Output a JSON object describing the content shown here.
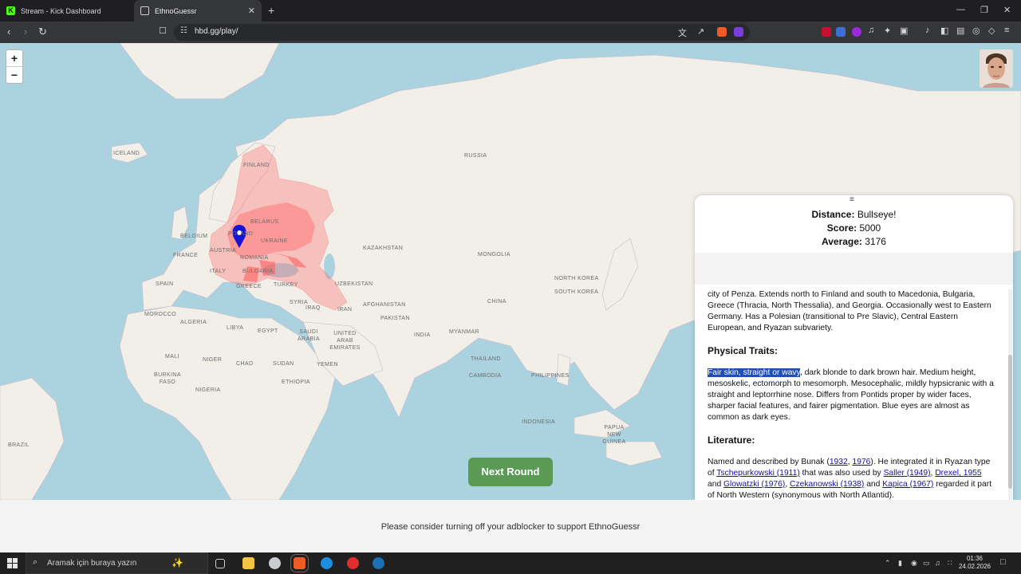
{
  "browser": {
    "tabs": [
      {
        "label": "Stream - Kick Dashboard",
        "active": false
      },
      {
        "label": "EthnoGuessr",
        "active": true
      }
    ],
    "new_tab": "+",
    "url": "hbd.gg/play/",
    "window_controls": {
      "minimize": "—",
      "restore": "❐",
      "close": "✕"
    }
  },
  "map": {
    "zoom_in": "+",
    "zoom_out": "−",
    "labels": {
      "iceland": "ICELAND",
      "finland": "FINLAND",
      "russia": "RUSSIA",
      "belarus": "BELARUS",
      "poland": "POLAND",
      "ukraine": "UKRAINE",
      "belgium": "BELGIUM",
      "austria": "AUSTRIA",
      "france": "FRANCE",
      "romania": "ROMANIA",
      "italy": "ITALY",
      "bulgaria": "BULGARIA",
      "greece": "GREECE",
      "turkey": "TURKEY",
      "spain": "SPAIN",
      "kazakhstan": "KAZAKHSTAN",
      "mongolia": "MONGOLIA",
      "uzbekistan": "UZBEKISTAN",
      "north_korea": "NORTH KOREA",
      "south_korea": "SOUTH KOREA",
      "china": "CHINA",
      "syria": "SYRIA",
      "iraq": "IRAQ",
      "iran": "IRAN",
      "afghanistan": "AFGHANISTAN",
      "pakistan": "PAKISTAN",
      "morocco": "MOROCCO",
      "algeria": "ALGERIA",
      "libya": "LIBYA",
      "egypt": "EGYPT",
      "saudi_arabia": "SAUDI ARABIA",
      "uae": "UNITED ARAB EMIRATES",
      "india": "INDIA",
      "myanmar": "MYANMAR",
      "thailand": "THAILAND",
      "philippines": "PHILIPPINES",
      "cambodia": "CAMBODIA",
      "mali": "MALI",
      "niger": "NIGER",
      "chad": "CHAD",
      "sudan": "SUDAN",
      "burkina_faso": "BURKINA FASO",
      "yemen": "YEMEN",
      "nigeria": "NIGERIA",
      "ethiopia": "ETHIOPIA",
      "indonesia": "INDONESIA",
      "brazil": "BRAZIL",
      "papua": "PAPUA NEW GUINEA"
    }
  },
  "result": {
    "handle": "≡",
    "distance_label": "Distance:",
    "distance_value": "Bullseye!",
    "score_label": "Score:",
    "score_value": "5000",
    "average_label": "Average:",
    "average_value": "3176",
    "intro": "city of Penza. Extends north to Finland and south to Macedonia, Bulgaria, Greece (Thracia, North Thessalia), and Georgia. Occasionally west to Eastern Germany. Has a Polesian (transitional to Pre Slavic), Central Eastern European, and Ryazan subvariety.",
    "physical_heading": "Physical Traits:",
    "physical_highlight": "Fair skin, straight or wavy",
    "physical_rest": ", dark blonde to dark brown hair. Medium height, mesoskelic, ectomorph to mesomorph. Mesocephalic, mildly hypsicranic with a straight and leptorrhine nose. Differs from Pontids proper by wider faces, sharper facial features, and fairer pigmentation. Blue eyes are almost as common as dark eyes.",
    "literature_heading": "Literature:",
    "lit": {
      "t1": "Named and described by Bunak (",
      "l1932": "1932",
      "c1": ", ",
      "l1976": "1976",
      "t2": "). He integrated it in Ryazan type of ",
      "ltsch": "Tschepurkowski (1911)",
      "t3": " that was also used by ",
      "lsaller": "Saller (1949)",
      "c2": ", ",
      "ldrexel": "Drexel, 1955",
      "t4": " and ",
      "lglow": "Glowatzki (1976)",
      "c3": ", ",
      "lczek": "Czekanowski (1938)",
      "t5": " and ",
      "lkapica": "Kapica (1967)",
      "t6": " regarded it part of North Western (synonymous with North Atlantid)."
    }
  },
  "next_round": "Next Round",
  "adblock_notice": "Please consider turning off your adblocker to support EthnoGuessr",
  "taskbar": {
    "search_placeholder": "Aramak için buraya yazın",
    "time": "01:36",
    "date": "24.02.2026"
  },
  "colors": {
    "accent_green": "#5a9a55",
    "highlight": "#1e4fb5",
    "region_red": "#ff6b6b",
    "marker_blue": "#1414d2"
  }
}
